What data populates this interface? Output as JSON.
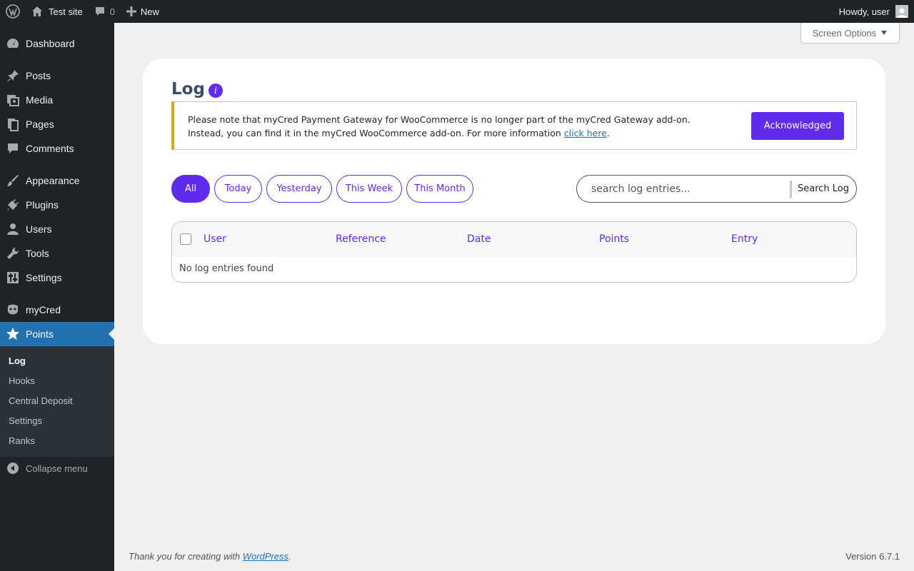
{
  "adminbar": {
    "site_name": "Test site",
    "comments_count": "0",
    "new_label": "New",
    "howdy": "Howdy, user"
  },
  "sidebar": {
    "items": [
      {
        "label": "Dashboard",
        "icon": "dashboard-icon"
      },
      {
        "label": "Posts",
        "icon": "pin-icon"
      },
      {
        "label": "Media",
        "icon": "media-icon"
      },
      {
        "label": "Pages",
        "icon": "pages-icon"
      },
      {
        "label": "Comments",
        "icon": "comment-icon"
      },
      {
        "label": "Appearance",
        "icon": "brush-icon"
      },
      {
        "label": "Plugins",
        "icon": "plug-icon"
      },
      {
        "label": "Users",
        "icon": "user-icon"
      },
      {
        "label": "Tools",
        "icon": "wrench-icon"
      },
      {
        "label": "Settings",
        "icon": "sliders-icon"
      },
      {
        "label": "myCred",
        "icon": "mycred-icon"
      },
      {
        "label": "Points",
        "icon": "star-icon",
        "current": true
      }
    ],
    "submenu": [
      "Log",
      "Hooks",
      "Central Deposit",
      "Settings",
      "Ranks"
    ],
    "collapse_label": "Collapse menu"
  },
  "screen_options": "Screen Options",
  "page": {
    "title": "Log",
    "notice": {
      "line1": "Please note that myCred Payment Gateway for WooCommerce is no longer part of the myCred Gateway add-on.",
      "line2": "Instead, you can find it in the myCred WooCommerce add-on. For more information",
      "link": "click here",
      "end": ".",
      "button": "Acknowledged"
    },
    "filters": [
      "All",
      "Today",
      "Yesterday",
      "This Week",
      "This Month"
    ],
    "search": {
      "placeholder": "search log entries...",
      "button": "Search Log"
    },
    "table": {
      "columns": [
        "User",
        "Reference",
        "Date",
        "Points",
        "Entry"
      ],
      "empty": "No log entries found"
    }
  },
  "footer": {
    "thanks": "Thank you for creating with",
    "link": "WordPress",
    "end": ".",
    "version": "Version 6.7.1"
  },
  "colors": {
    "accent": "#5f2ced",
    "wp_blue": "#2271b1",
    "notice_warning": "#dba617",
    "admin_dark": "#1d2327"
  }
}
